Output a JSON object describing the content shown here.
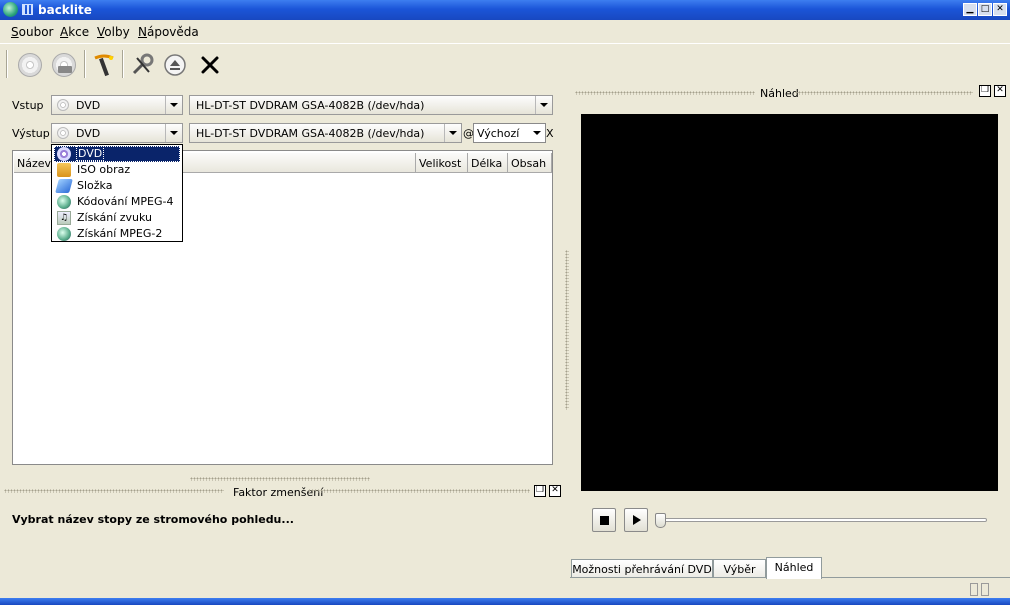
{
  "window": {
    "title": "backlite"
  },
  "menu": [
    {
      "label": "Soubor",
      "mnemonic": "S",
      "rest": "oubor"
    },
    {
      "label": "Akce",
      "mnemonic": "A",
      "rest": "kce"
    },
    {
      "label": "Volby",
      "mnemonic": "V",
      "rest": "olby"
    },
    {
      "label": "Nápověda",
      "mnemonic": "N",
      "rest": "ápověda"
    }
  ],
  "toolbar": {
    "icons": [
      "cd-icon",
      "dvd-copy-icon",
      "magic-wand-icon",
      "settings-tools-icon",
      "eject-icon",
      "close-x-icon"
    ]
  },
  "input": {
    "label": "Vstup",
    "type": "DVD",
    "device": "HL-DT-ST DVDRAM GSA-4082B  (/dev/hda)"
  },
  "output": {
    "label": "Výstup",
    "type": "DVD",
    "device": "HL-DT-ST DVDRAM GSA-4082B  (/dev/hda)",
    "at": "@",
    "speed": "Výchozí",
    "x": "X"
  },
  "output_type_options": [
    {
      "label": "DVD",
      "icon": "dvd-icon",
      "selected": true
    },
    {
      "label": "ISO obraz",
      "icon": "folder-icon"
    },
    {
      "label": "Složka",
      "icon": "folder-blue-icon"
    },
    {
      "label": "Kódování MPEG-4",
      "icon": "film-encode-icon"
    },
    {
      "label": "Získání zvuku",
      "icon": "audio-extract-icon"
    },
    {
      "label": "Získání MPEG-2",
      "icon": "film-extract-icon"
    }
  ],
  "table": {
    "columns": [
      "Název",
      "Velikost",
      "Délka",
      "Obsah"
    ]
  },
  "scale_panel": {
    "title": "Faktor zmenšení",
    "message": "Vybrat název stopy ze stromového pohledu..."
  },
  "preview_panel": {
    "title": "Náhled"
  },
  "tabs": [
    {
      "label": "Možnosti přehrávání DVD"
    },
    {
      "label": "Výběr"
    },
    {
      "label": "Náhled",
      "active": true
    }
  ],
  "colors": {
    "titlebar": "#1b55d8",
    "selection": "#0a246a",
    "preview_bg": "#000000"
  }
}
